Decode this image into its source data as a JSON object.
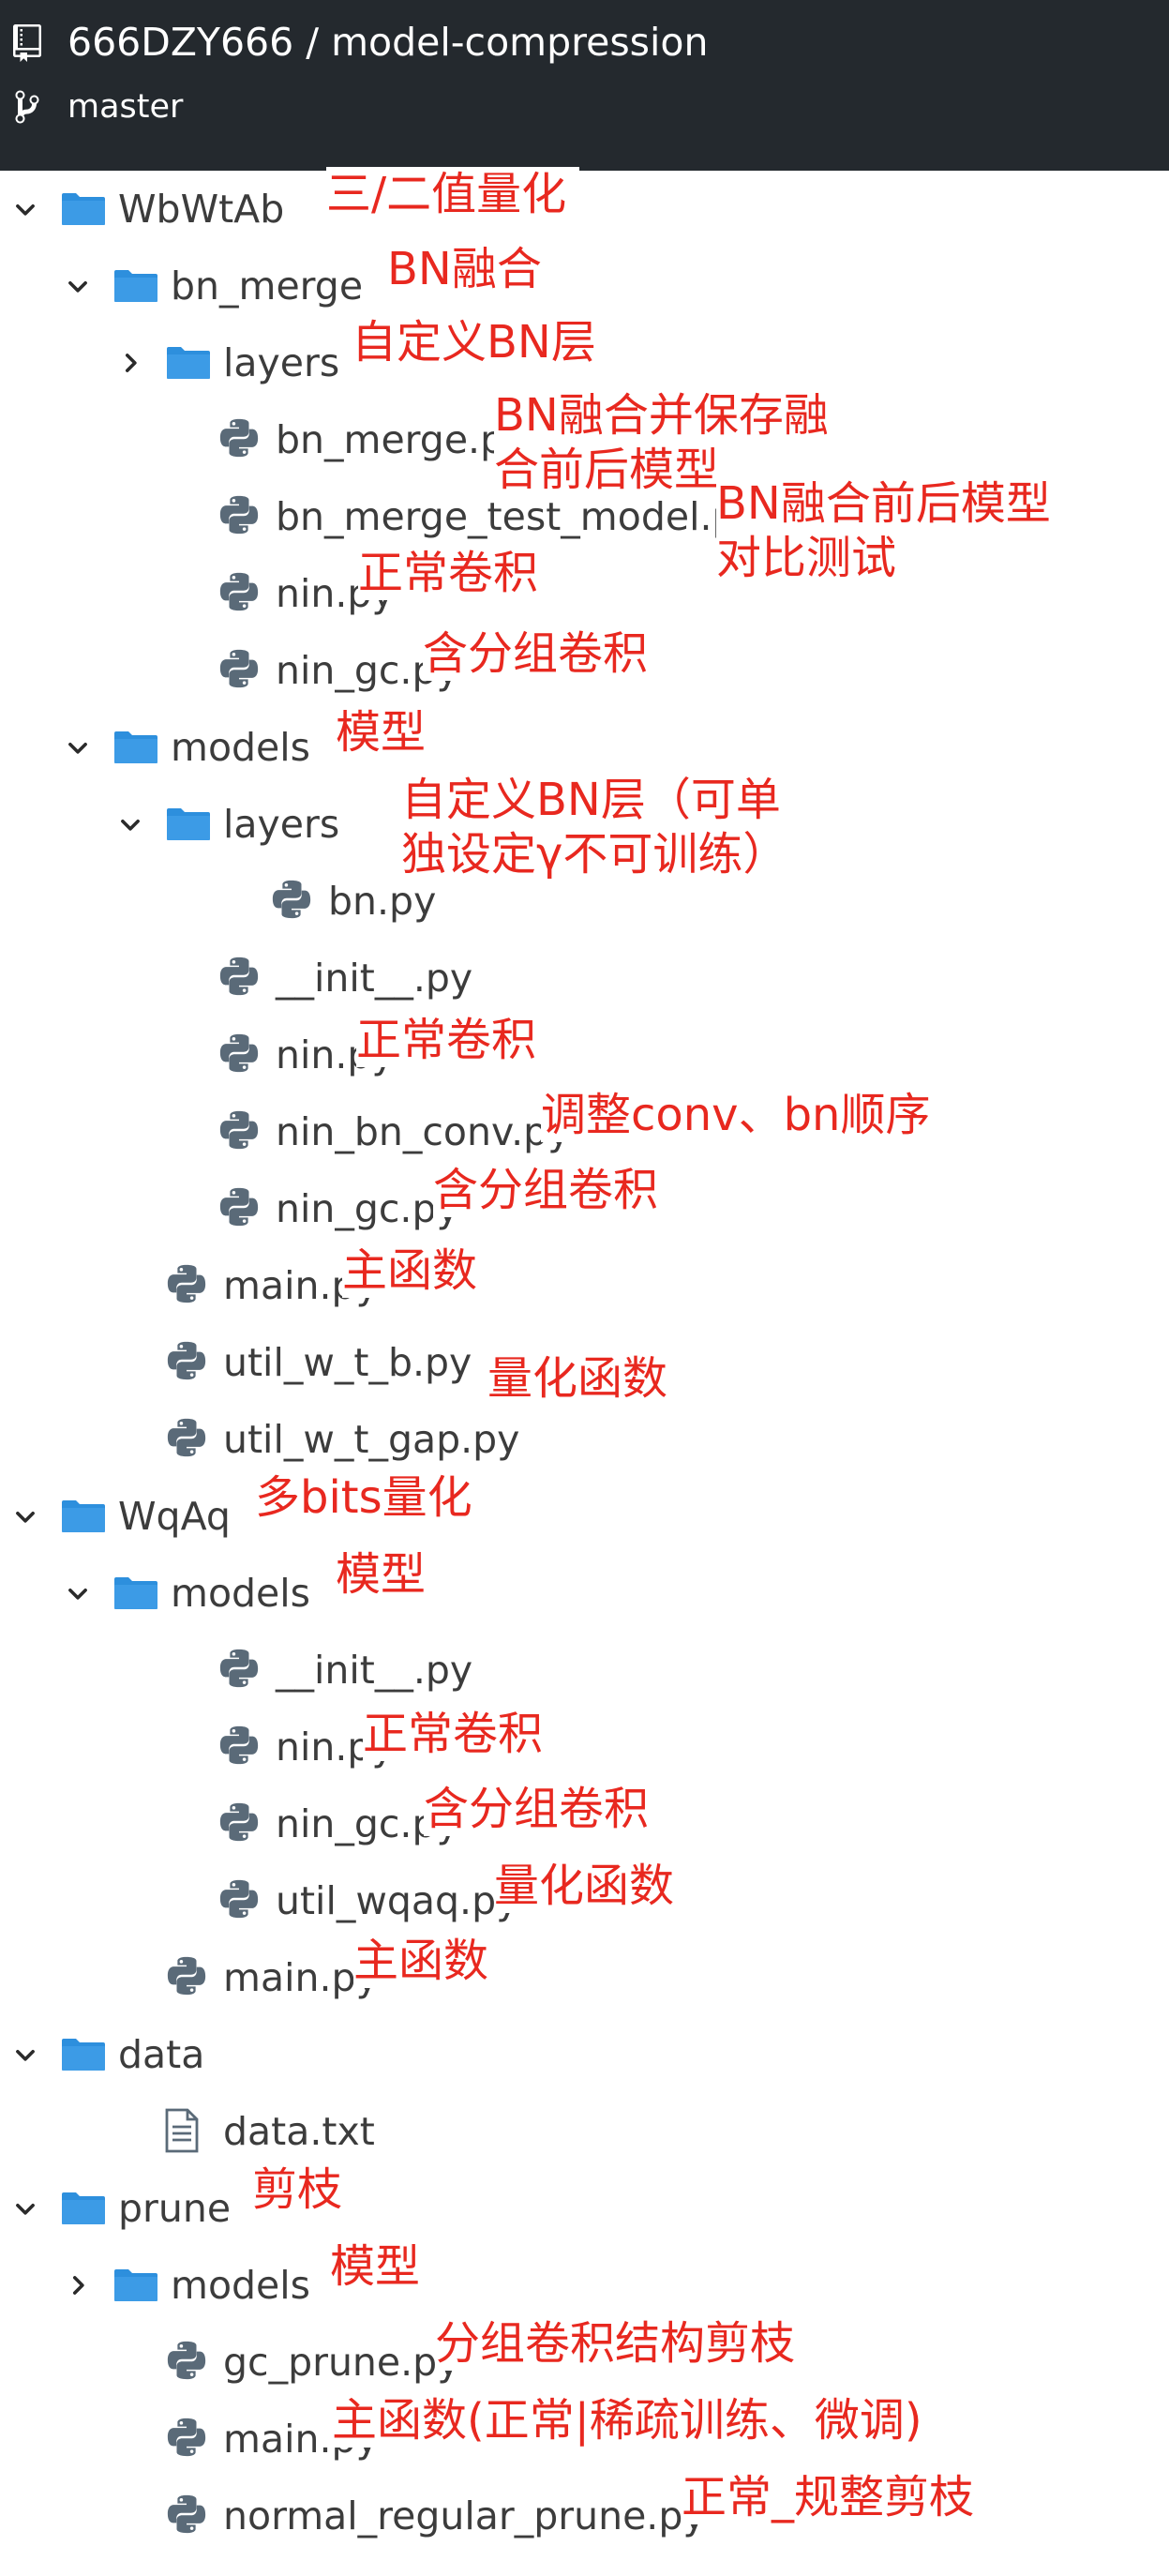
{
  "header": {
    "repo_title": "666DZY666 / model-compression",
    "branch": "master",
    "repo_icon": "repo-icon",
    "branch_icon": "git-branch-icon"
  },
  "colors": {
    "header_bg": "#24292e",
    "folder": "#2d8fdd",
    "annotation": "#e8281f",
    "text": "#3c3c3c"
  },
  "tree": [
    {
      "name": "WbWtAb",
      "type": "folder",
      "state": "expanded",
      "note": [
        "三/二值量化"
      ]
    },
    {
      "name": "bn_merge",
      "type": "folder",
      "state": "expanded",
      "note": [
        "BN融合"
      ]
    },
    {
      "name": "layers",
      "type": "folder",
      "state": "collapsed",
      "note": [
        "自定义BN层"
      ]
    },
    {
      "name": "bn_merge.py",
      "type": "py",
      "note": [
        "BN融合并保存融",
        "合前后模型"
      ]
    },
    {
      "name": "bn_merge_test_model.py",
      "type": "py",
      "note": [
        "BN融合前后模型",
        "对比测试"
      ]
    },
    {
      "name": "nin.py",
      "type": "py",
      "note": [
        "正常卷积"
      ]
    },
    {
      "name": "nin_gc.py",
      "type": "py",
      "note": [
        "含分组卷积"
      ]
    },
    {
      "name": "models",
      "type": "folder",
      "state": "expanded",
      "note": [
        "模型"
      ]
    },
    {
      "name": "layers",
      "type": "folder",
      "state": "expanded",
      "note": [
        "自定义BN层（可单",
        "独设定γ不可训练）"
      ]
    },
    {
      "name": "bn.py",
      "type": "py",
      "note": []
    },
    {
      "name": "__init__.py",
      "type": "py",
      "note": []
    },
    {
      "name": "nin.py",
      "type": "py",
      "note": [
        "正常卷积"
      ]
    },
    {
      "name": "nin_bn_conv.py",
      "type": "py",
      "note": [
        "调整conv、bn顺序"
      ]
    },
    {
      "name": "nin_gc.py",
      "type": "py",
      "note": [
        "含分组卷积"
      ]
    },
    {
      "name": "main.py",
      "type": "py",
      "note": [
        "主函数"
      ]
    },
    {
      "name": "util_w_t_b.py",
      "type": "py",
      "note": [
        "量化函数"
      ]
    },
    {
      "name": "util_w_t_gap.py",
      "type": "py",
      "note": []
    },
    {
      "name": "WqAq",
      "type": "folder",
      "state": "expanded",
      "note": [
        "多bits量化"
      ]
    },
    {
      "name": "models",
      "type": "folder",
      "state": "expanded",
      "note": [
        "模型"
      ]
    },
    {
      "name": "__init__.py",
      "type": "py",
      "note": []
    },
    {
      "name": "nin.py",
      "type": "py",
      "note": [
        "正常卷积"
      ]
    },
    {
      "name": "nin_gc.py",
      "type": "py",
      "note": [
        "含分组卷积"
      ]
    },
    {
      "name": "util_wqaq.py",
      "type": "py",
      "note": [
        "量化函数"
      ]
    },
    {
      "name": "main.py",
      "type": "py",
      "note": [
        "主函数"
      ]
    },
    {
      "name": "data",
      "type": "folder",
      "state": "expanded",
      "note": []
    },
    {
      "name": "data.txt",
      "type": "txt",
      "note": []
    },
    {
      "name": "prune",
      "type": "folder",
      "state": "expanded",
      "note": [
        "剪枝"
      ]
    },
    {
      "name": "models",
      "type": "folder",
      "state": "collapsed",
      "note": [
        "模型"
      ]
    },
    {
      "name": "gc_prune.py",
      "type": "py",
      "note": [
        "分组卷积结构剪枝"
      ]
    },
    {
      "name": "main.py",
      "type": "py",
      "note": [
        "主函数(正常|稀疏训练、微调)"
      ]
    },
    {
      "name": "normal_regular_prune.py",
      "type": "py",
      "note": [
        "正常_规整剪枝"
      ]
    }
  ]
}
